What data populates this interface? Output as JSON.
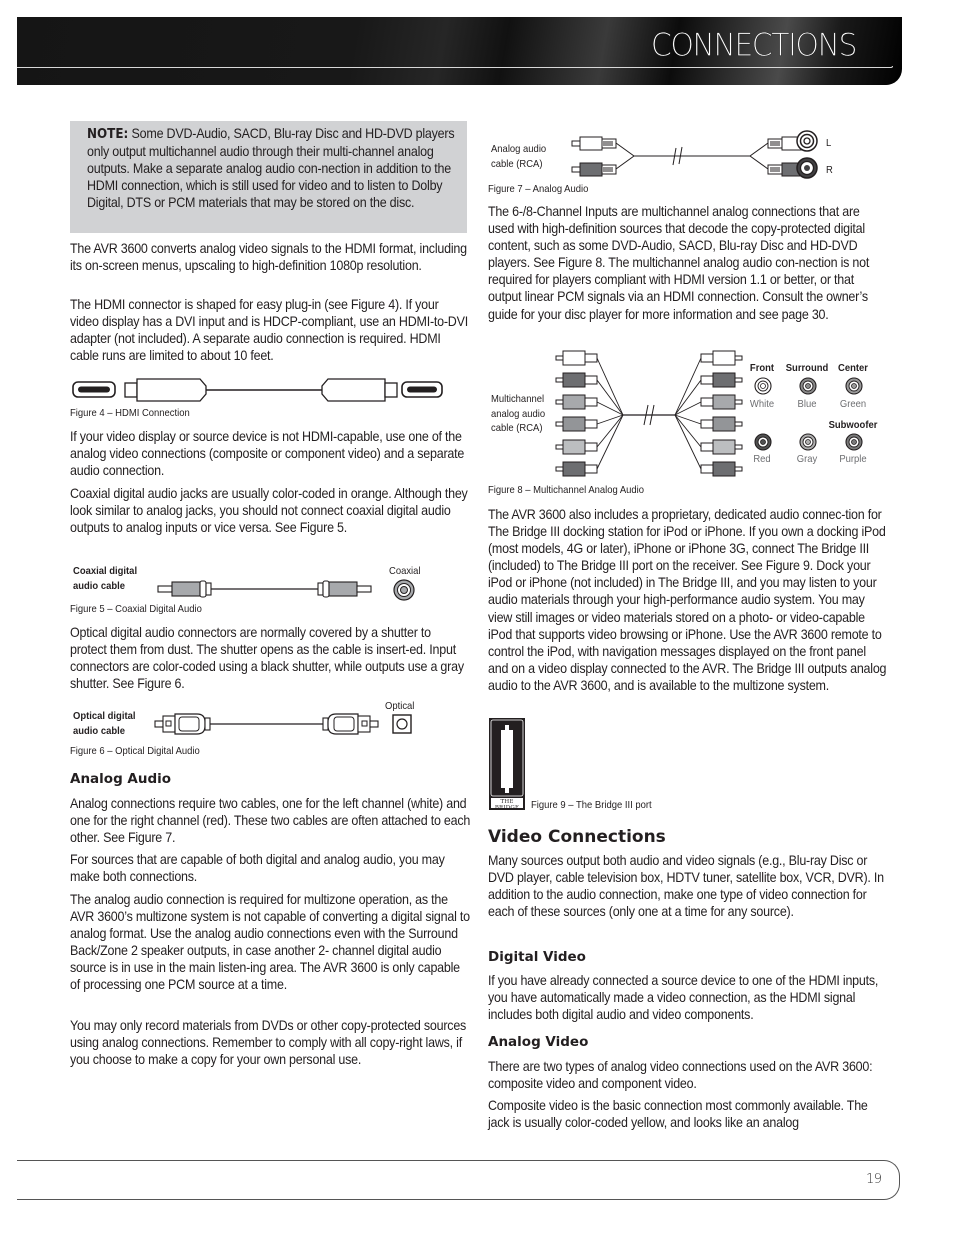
{
  "header": {
    "title": "CONNECTIONS"
  },
  "note": {
    "label": "NOTE:",
    "text": " Some DVD-Audio, SACD, Blu-ray Disc and HD-DVD players only output multichannel audio through their multi-channel analog outputs. Make a separate analog audio con-nection in addition to the HDMI connection, which is still used for video and to listen to Dolby Digital, DTS or PCM materials that may be stored on the disc."
  },
  "left_column": {
    "para_1": "The AVR 3600 converts analog video signals to the HDMI format, including its on-screen menus, upscaling to high-definition 1080p resolution.",
    "para_2": "The HDMI connector is shaped for easy plug-in (see Figure 4). If your video display has a DVI input and is HDCP-compliant, use an HDMI-to-DVI adapter (not included). A separate audio connection is required. HDMI cable runs are limited to about 10 feet.",
    "figure_4_caption": "Figure 4 – HDMI Connection",
    "para_3": "If your video display or source device is not HDMI-capable, use one of the analog video connections (composite or component video) and a separate audio connection.",
    "para_4": "Coaxial digital audio jacks are usually color-coded in orange. Although they look similar to analog jacks, you should not connect coaxial digital audio outputs to analog inputs or vice versa. See Figure 5.",
    "figure_5": {
      "cable_label_line1": "Coaxial digital",
      "cable_label_line2": "audio cable",
      "jack_label": "Coaxial",
      "caption": "Figure 5 – Coaxial Digital Audio"
    },
    "para_5": "Optical digital audio connectors are normally covered by a shutter to protect them from dust. The shutter opens as the cable is insert-ed. Input connectors are color-coded using a black shutter, while outputs use a gray shutter. See Figure 6.",
    "figure_6": {
      "cable_label_line1": "Optical digital",
      "cable_label_line2": "audio cable",
      "jack_label": "Optical",
      "caption": "Figure 6 – Optical Digital Audio"
    },
    "analog_audio_heading": "Analog Audio",
    "para_6": "Analog connections require two cables, one for the left channel (white) and one for the right channel (red). These two cables are often attached to each other. See Figure 7.",
    "para_7": "For sources that are capable of both digital and analog audio, you may make both connections.",
    "para_8": "The analog audio connection is required for multizone operation, as the AVR 3600’s multizone system is not capable of converting a digital signal to analog format. Use the analog audio connections even with the Surround Back/Zone 2 speaker outputs, in case another 2- channel digital audio source is in use in the main listen-ing area. The AVR 3600 is only capable of processing one PCM source at a time.",
    "para_9": "You may only record materials from DVDs or other copy-protected sources using analog connections. Remember to comply with all copy-right laws, if you choose to make a copy for your own personal use."
  },
  "right_column": {
    "figure_7": {
      "cable_label_line1": "Analog audio",
      "cable_label_line2": "cable (RCA)",
      "jack_left": "L",
      "jack_right": "R",
      "caption": "Figure 7 – Analog Audio"
    },
    "para_1": "The 6-/8-Channel Inputs are multichannel analog connections that are used with high-definition sources that decode the copy-protected digital content, such as some DVD-Audio, SACD, Blu-ray Disc and HD-DVD players. See Figure 8. The multichannel analog audio con-nection is not required for players compliant with HDMI version 1.1 or better, or that output linear PCM signals via an HDMI connection. Consult the owner’s guide for your disc player for more information and see page 30.",
    "figure_8": {
      "cable_label_line1": "Multichannel",
      "cable_label_line2": "analog audio",
      "cable_label_line3": "cable (RCA)",
      "jacks": [
        {
          "heading": "Front",
          "color_name": "White",
          "color": "#ffffff"
        },
        {
          "heading": "Surround",
          "color_name": "Blue",
          "color": "#8a8a8a"
        },
        {
          "heading": "Center",
          "color_name": "Green",
          "color": "#9a9a9a"
        },
        {
          "heading": "",
          "color_name": "Red",
          "color": "#505050"
        },
        {
          "heading": "",
          "color_name": "Gray",
          "color": "#b0b0b0"
        },
        {
          "heading": "Subwoofer",
          "color_name": "Purple",
          "color": "#7a7a7a"
        }
      ],
      "caption": "Figure 8 – Multichannel Analog Audio"
    },
    "para_2": "The AVR 3600 also includes a proprietary, dedicated audio connec-tion for The Bridge III docking station for iPod or iPhone. If you own a docking iPod (most models, 4G or later), iPhone or iPhone 3G, connect The Bridge III (included) to The Bridge III port on the receiver. See Figure 9. Dock your iPod or iPhone (not included) in The Bridge III, and you may listen to your audio materials through your high-performance audio system. You may view still images or video materials stored on a photo- or video-capable iPod that supports video browsing or iPhone. Use the AVR 3600 remote to control the iPod, with navigation messages displayed on the front panel and on a video display connected to the AVR. The Bridge III outputs analog audio to the AVR 3600, and is available to the multizone system.",
    "figure_9": {
      "port_label": "THE BRIDGE",
      "caption": "Figure 9 –  The Bridge III port"
    },
    "video_heading": "Video Connections",
    "para_3": "Many sources output both audio and video signals (e.g., Blu-ray Disc or DVD player, cable television box, HDTV tuner, satellite box, VCR, DVR). In addition to the audio connection, make one type of video connection for each of these sources (only one at a time for any source).",
    "digital_video_heading": "Digital Video",
    "para_4": "If you have already connected a source device to one of the HDMI inputs, you have automatically made a video connection, as the HDMI signal includes both digital audio and video components.",
    "analog_video_heading": "Analog Video",
    "para_5": "There are two types of analog video connections used on the AVR 3600: composite video and component video.",
    "para_6": "Composite video is the basic connection most commonly available. The jack is usually color-coded yellow, and looks like an analog"
  },
  "footer": {
    "page_number": "19"
  }
}
